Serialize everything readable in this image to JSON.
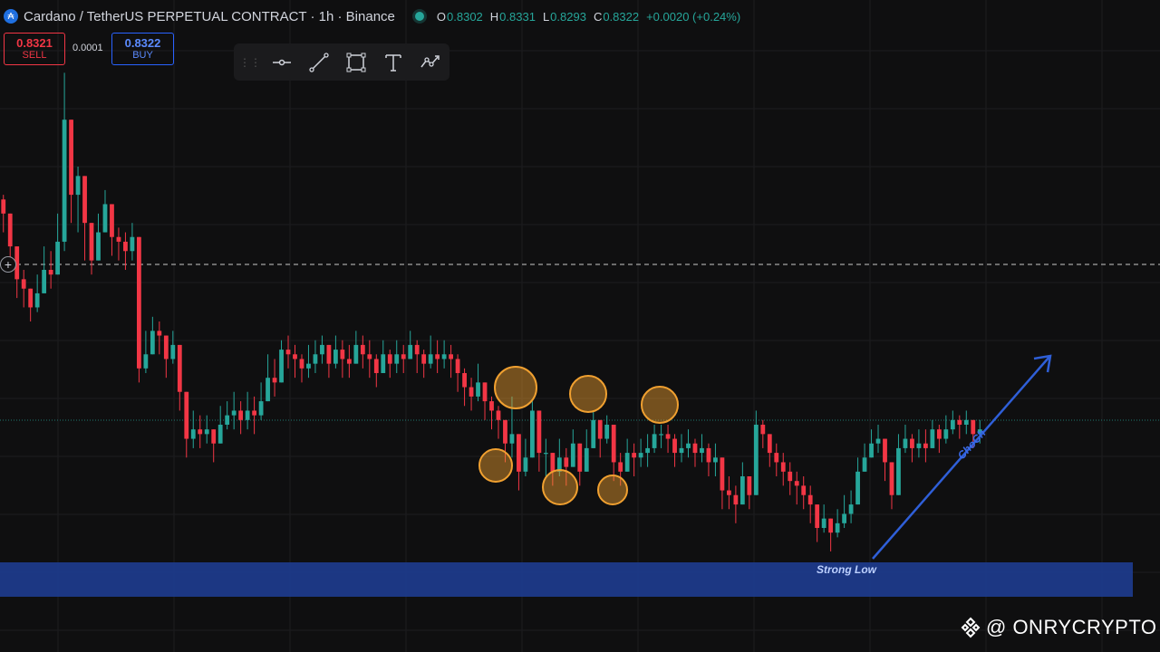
{
  "header": {
    "symbol_title": "Cardano / TetherUS PERPETUAL CONTRACT · 1h · Binance",
    "open_label": "O",
    "open": "0.8302",
    "high_label": "H",
    "high": "0.8331",
    "low_label": "L",
    "low": "0.8293",
    "close_label": "C",
    "close": "0.8322",
    "change": "+0.0020 (+0.24%)"
  },
  "trade": {
    "sell_price": "0.8321",
    "sell_label": "SELL",
    "spread": "0.0001",
    "buy_price": "0.8322",
    "buy_label": "BUY"
  },
  "toolbar": {
    "items": [
      "grip-icon",
      "horizontal-line-icon",
      "trend-line-icon",
      "rectangle-icon",
      "text-icon",
      "path-icon"
    ]
  },
  "annotations": {
    "zone_label": "Strong Low",
    "arrow_label": "ChoCh"
  },
  "watermark": {
    "text": "@ ONRYCRYPTO"
  },
  "colors": {
    "background": "#0f0f10",
    "bull": "#26a69a",
    "bear": "#f23645",
    "zone": "#1e3a8a",
    "arrow": "#2f5fd8",
    "circle": "#f0a030"
  },
  "chart_data": {
    "type": "candlestick",
    "title": "Cardano / TetherUS PERPETUAL CONTRACT · 1h · Binance",
    "series": [
      {
        "name": "ADAUSDT",
        "close": [
          0.878,
          0.871,
          0.864,
          0.862,
          0.858,
          0.861,
          0.866,
          0.865,
          0.872,
          0.898,
          0.882,
          0.886,
          0.876,
          0.868,
          0.874,
          0.88,
          0.873,
          0.872,
          0.87,
          0.873,
          0.845,
          0.848,
          0.853,
          0.852,
          0.847,
          0.85,
          0.84,
          0.83,
          0.832,
          0.831,
          0.832,
          0.829,
          0.833,
          0.835,
          0.836,
          0.834,
          0.836,
          0.835,
          0.838,
          0.843,
          0.842,
          0.849,
          0.848,
          0.847,
          0.845,
          0.846,
          0.848,
          0.85,
          0.846,
          0.849,
          0.847,
          0.846,
          0.85,
          0.848,
          0.847,
          0.844,
          0.848,
          0.846,
          0.848,
          0.847,
          0.85,
          0.848,
          0.846,
          0.848,
          0.847,
          0.848,
          0.847,
          0.844,
          0.841,
          0.839,
          0.842,
          0.838,
          0.836,
          0.834,
          0.829,
          0.831,
          0.823,
          0.826,
          0.836,
          0.827,
          0.827,
          0.823,
          0.826,
          0.824,
          0.829,
          0.823,
          0.828,
          0.834,
          0.83,
          0.833,
          0.825,
          0.823,
          0.827,
          0.826,
          0.827,
          0.828,
          0.831,
          0.831,
          0.83,
          0.827,
          0.828,
          0.829,
          0.827,
          0.828,
          0.825,
          0.826,
          0.819,
          0.818,
          0.816,
          0.822,
          0.818,
          0.833,
          0.831,
          0.827,
          0.825,
          0.823,
          0.821,
          0.82,
          0.818,
          0.816,
          0.811,
          0.813,
          0.81,
          0.812,
          0.814,
          0.816,
          0.823,
          0.826,
          0.829,
          0.83,
          0.825,
          0.818,
          0.828,
          0.83,
          0.828,
          0.829,
          0.828,
          0.832,
          0.83,
          0.832,
          0.834,
          0.833,
          0.834,
          0.831,
          0.832
        ],
        "high": [
          0.882,
          0.875,
          0.869,
          0.866,
          0.862,
          0.865,
          0.871,
          0.87,
          0.878,
          0.908,
          0.892,
          0.888,
          0.88,
          0.871,
          0.878,
          0.883,
          0.876,
          0.875,
          0.874,
          0.876,
          0.85,
          0.853,
          0.856,
          0.855,
          0.85,
          0.853,
          0.844,
          0.834,
          0.836,
          0.835,
          0.835,
          0.832,
          0.837,
          0.838,
          0.84,
          0.838,
          0.84,
          0.839,
          0.842,
          0.848,
          0.847,
          0.851,
          0.852,
          0.85,
          0.848,
          0.85,
          0.851,
          0.852,
          0.85,
          0.852,
          0.851,
          0.85,
          0.853,
          0.852,
          0.851,
          0.848,
          0.851,
          0.849,
          0.851,
          0.85,
          0.853,
          0.851,
          0.849,
          0.852,
          0.851,
          0.851,
          0.85,
          0.848,
          0.845,
          0.843,
          0.846,
          0.842,
          0.839,
          0.837,
          0.834,
          0.839,
          0.827,
          0.83,
          0.838,
          0.83,
          0.83,
          0.827,
          0.83,
          0.828,
          0.832,
          0.828,
          0.832,
          0.836,
          0.834,
          0.835,
          0.829,
          0.827,
          0.83,
          0.829,
          0.83,
          0.831,
          0.833,
          0.833,
          0.833,
          0.831,
          0.831,
          0.832,
          0.83,
          0.831,
          0.829,
          0.829,
          0.823,
          0.822,
          0.82,
          0.825,
          0.822,
          0.836,
          0.834,
          0.831,
          0.829,
          0.827,
          0.825,
          0.823,
          0.822,
          0.82,
          0.815,
          0.816,
          0.813,
          0.815,
          0.818,
          0.819,
          0.826,
          0.829,
          0.832,
          0.833,
          0.829,
          0.823,
          0.831,
          0.833,
          0.831,
          0.832,
          0.832,
          0.834,
          0.833,
          0.835,
          0.836,
          0.835,
          0.836,
          0.834,
          0.834
        ],
        "low": [
          0.874,
          0.867,
          0.86,
          0.858,
          0.855,
          0.857,
          0.862,
          0.862,
          0.866,
          0.87,
          0.876,
          0.874,
          0.868,
          0.865,
          0.87,
          0.875,
          0.869,
          0.868,
          0.866,
          0.868,
          0.842,
          0.844,
          0.849,
          0.848,
          0.843,
          0.846,
          0.836,
          0.826,
          0.828,
          0.828,
          0.829,
          0.825,
          0.829,
          0.832,
          0.832,
          0.831,
          0.832,
          0.831,
          0.834,
          0.838,
          0.839,
          0.844,
          0.845,
          0.843,
          0.842,
          0.843,
          0.844,
          0.846,
          0.843,
          0.845,
          0.843,
          0.843,
          0.846,
          0.845,
          0.843,
          0.841,
          0.844,
          0.843,
          0.844,
          0.844,
          0.847,
          0.844,
          0.843,
          0.845,
          0.844,
          0.845,
          0.843,
          0.84,
          0.837,
          0.836,
          0.838,
          0.834,
          0.832,
          0.83,
          0.825,
          0.826,
          0.819,
          0.822,
          0.826,
          0.823,
          0.822,
          0.82,
          0.822,
          0.82,
          0.825,
          0.82,
          0.824,
          0.83,
          0.826,
          0.829,
          0.821,
          0.82,
          0.823,
          0.822,
          0.824,
          0.824,
          0.827,
          0.828,
          0.827,
          0.824,
          0.825,
          0.826,
          0.824,
          0.825,
          0.822,
          0.822,
          0.815,
          0.815,
          0.812,
          0.818,
          0.815,
          0.826,
          0.828,
          0.824,
          0.822,
          0.82,
          0.818,
          0.816,
          0.815,
          0.812,
          0.808,
          0.81,
          0.806,
          0.809,
          0.811,
          0.812,
          0.819,
          0.823,
          0.826,
          0.827,
          0.821,
          0.815,
          0.824,
          0.827,
          0.825,
          0.826,
          0.825,
          0.828,
          0.827,
          0.829,
          0.831,
          0.83,
          0.831,
          0.828,
          0.829
        ]
      }
    ],
    "price_line": 0.8322,
    "ylim": [
      0.8,
      0.91
    ]
  }
}
